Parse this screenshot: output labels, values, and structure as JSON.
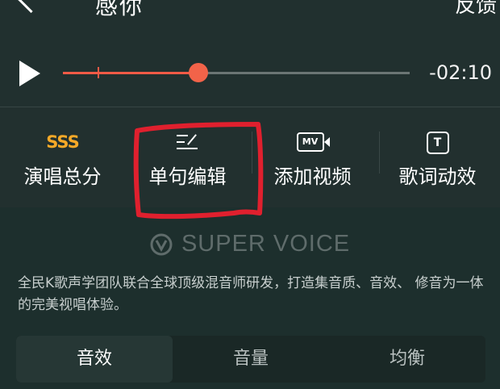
{
  "header": {
    "title": "感你",
    "feedback_label": "反馈"
  },
  "player": {
    "progress": 0.39,
    "marker_position": 0.1,
    "remaining_time": "-02:10",
    "accent_color": "#f05a46"
  },
  "tools": [
    {
      "icon_text": "SSS",
      "icon": "score-icon",
      "label": "演唱总分"
    },
    {
      "icon_text": "",
      "icon": "edit-lines-icon",
      "label": "单句编辑"
    },
    {
      "icon_text": "MV",
      "icon": "mv-camera-icon",
      "label": "添加视频"
    },
    {
      "icon_text": "T",
      "icon": "lyric-effect-icon",
      "label": "歌词动效"
    }
  ],
  "annotation": {
    "color": "#e0202e",
    "target": "单句编辑"
  },
  "brand": {
    "name": "SUPER VOICE",
    "description": "全民K歌声学团队联合全球顶级混音师研发，打造集音质、音效、 修音为一体的完美视唱体验。"
  },
  "tabs": [
    {
      "label": "音效",
      "active": true
    },
    {
      "label": "音量",
      "active": false
    },
    {
      "label": "均衡",
      "active": false
    }
  ]
}
